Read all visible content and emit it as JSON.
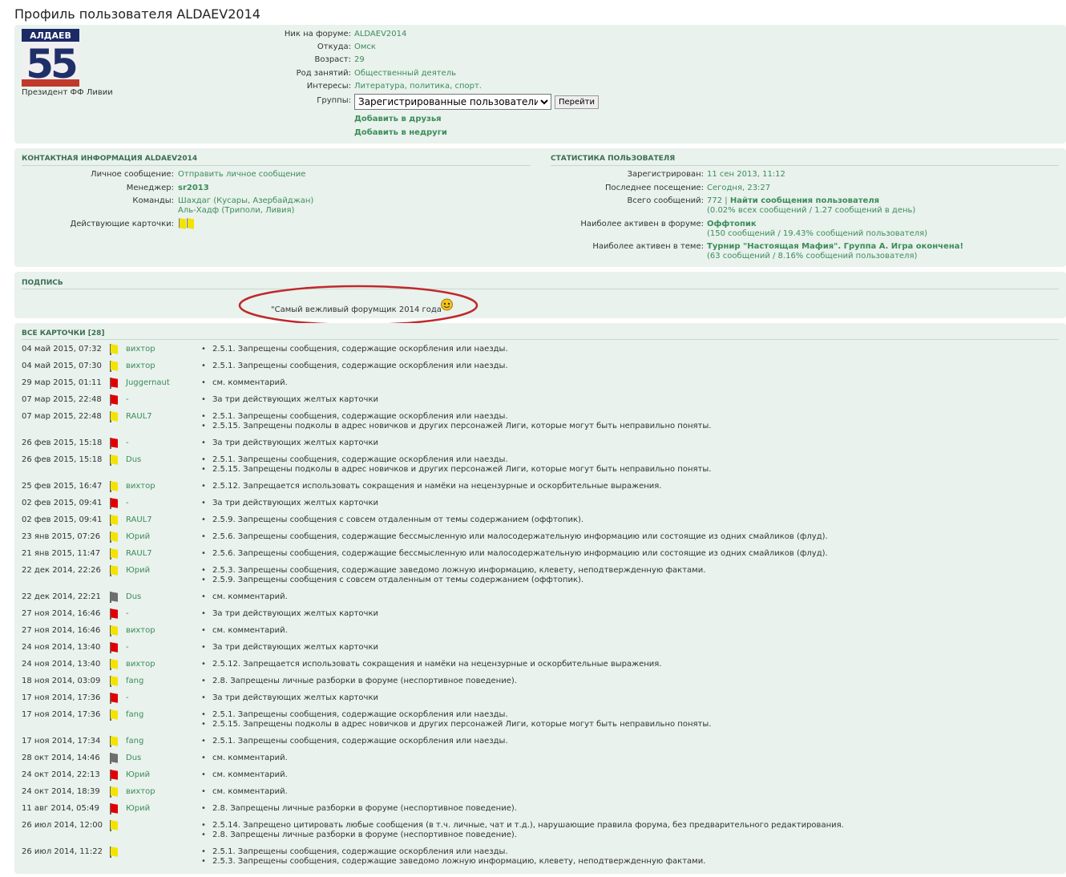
{
  "page_title": "Профиль пользователя ALDAEV2014",
  "profile": {
    "avatar_name": "АЛДАЕВ",
    "avatar_number": "55",
    "rank": "Президент ФФ Ливии",
    "fields": {
      "nick_label": "Ник на форуме:",
      "nick": "ALDAEV2014",
      "from_label": "Откуда:",
      "from": "Омск",
      "age_label": "Возраст:",
      "age": "29",
      "occupation_label": "Род занятий:",
      "occupation": "Общественный деятель",
      "interests_label": "Интересы:",
      "interests": "Литература, политика, спорт.",
      "groups_label": "Группы:"
    },
    "group_selected": "Зарегистрированные пользователи",
    "go_button": "Перейти",
    "add_friend": "Добавить в друзья",
    "add_foe": "Добавить в недруги"
  },
  "contact": {
    "title": "КОНТАКТНАЯ ИНФОРМАЦИЯ ALDAEV2014",
    "pm_label": "Личное сообщение:",
    "pm_link": "Отправить личное сообщение",
    "manager_label": "Менеджер:",
    "manager": "sr2013",
    "teams_label": "Команды:",
    "team1": "Шахдаг (Кусары, Азербайджан)",
    "team2": "Аль-Хадф (Триполи, Ливия)",
    "cards_label": "Действующие карточки:"
  },
  "stats": {
    "title": "СТАТИСТИКА ПОЛЬЗОВАТЕЛЯ",
    "registered_label": "Зарегистрирован:",
    "registered": "11 сен 2013, 11:12",
    "last_visit_label": "Последнее посещение:",
    "last_visit": "Сегодня, 23:27",
    "posts_label": "Всего сообщений:",
    "posts": "772",
    "posts_sep": "|",
    "find_posts": "Найти сообщения пользователя",
    "posts_detail": "(0.02% всех сообщений / 1.27 сообщений в день)",
    "active_forum_label": "Наиболее активен в форуме:",
    "active_forum": "Оффтопик",
    "active_forum_detail": "(150 сообщений / 19.43% сообщений пользователя)",
    "active_topic_label": "Наиболее активен в теме:",
    "active_topic": "Турнир \"Настоящая Мафия\". Группа А. Игра окончена!",
    "active_topic_detail": "(63 сообщений / 8.16% сообщений пользователя)"
  },
  "signature": {
    "title": "ПОДПИСЬ",
    "text": "\"Самый вежливый форумщик 2014 года\""
  },
  "cards": {
    "title": "ВСЕ КАРТОЧКИ",
    "count": "[28]",
    "rows": [
      {
        "date": "04 май 2015, 07:32",
        "color": "yellow",
        "mod": "вихтор",
        "reasons": [
          "2.5.1. Запрещены сообщения, содержащие оскорбления или наезды."
        ]
      },
      {
        "date": "04 май 2015, 07:30",
        "color": "yellow",
        "mod": "вихтор",
        "reasons": [
          "2.5.1. Запрещены сообщения, содержащие оскорбления или наезды."
        ]
      },
      {
        "date": "29 мар 2015, 01:11",
        "color": "red",
        "mod": "Juggernaut",
        "reasons": [
          "см. комментарий."
        ]
      },
      {
        "date": "07 мар 2015, 22:48",
        "color": "red",
        "mod": "-",
        "reasons": [
          "За три действующих желтых карточки"
        ]
      },
      {
        "date": "07 мар 2015, 22:48",
        "color": "yellow",
        "mod": "RAUL7",
        "reasons": [
          "2.5.1. Запрещены сообщения, содержащие оскорбления или наезды.",
          "2.5.15. Запрещены подколы в адрес новичков и других персонажей Лиги, которые могут быть неправильно поняты."
        ]
      },
      {
        "date": "26 фев 2015, 15:18",
        "color": "red",
        "mod": "-",
        "reasons": [
          "За три действующих желтых карточки"
        ]
      },
      {
        "date": "26 фев 2015, 15:18",
        "color": "yellow",
        "mod": "Dus",
        "reasons": [
          "2.5.1. Запрещены сообщения, содержащие оскорбления или наезды.",
          "2.5.15. Запрещены подколы в адрес новичков и других персонажей Лиги, которые могут быть неправильно поняты."
        ]
      },
      {
        "date": "25 фев 2015, 16:47",
        "color": "yellow",
        "mod": "вихтор",
        "reasons": [
          "2.5.12. Запрещается использовать сокращения и намёки на нецензурные и оскорбительные выражения."
        ]
      },
      {
        "date": "02 фев 2015, 09:41",
        "color": "red",
        "mod": "-",
        "reasons": [
          "За три действующих желтых карточки"
        ]
      },
      {
        "date": "02 фев 2015, 09:41",
        "color": "yellow",
        "mod": "RAUL7",
        "reasons": [
          "2.5.9. Запрещены сообщения с совсем отдаленным от темы содержанием (оффтопик)."
        ]
      },
      {
        "date": "23 янв 2015, 07:26",
        "color": "yellow",
        "mod": "Юрий",
        "reasons": [
          "2.5.6. Запрещены сообщения, содержащие бессмысленную или малосодержательную информацию или состоящие из одних смайликов (флуд)."
        ]
      },
      {
        "date": "21 янв 2015, 11:47",
        "color": "yellow",
        "mod": "RAUL7",
        "reasons": [
          "2.5.6. Запрещены сообщения, содержащие бессмысленную или малосодержательную информацию или состоящие из одних смайликов (флуд)."
        ]
      },
      {
        "date": "22 дек 2014, 22:26",
        "color": "yellow",
        "mod": "Юрий",
        "reasons": [
          "2.5.3. Запрещены сообщения, содержащие заведомо ложную информацию, клевету, неподтвержденную фактами.",
          "2.5.9. Запрещены сообщения с совсем отдаленным от темы содержанием (оффтопик)."
        ]
      },
      {
        "date": "22 дек 2014, 22:21",
        "color": "gray",
        "mod": "Dus",
        "reasons": [
          "см. комментарий."
        ]
      },
      {
        "date": "27 ноя 2014, 16:46",
        "color": "red",
        "mod": "-",
        "reasons": [
          "За три действующих желтых карточки"
        ]
      },
      {
        "date": "27 ноя 2014, 16:46",
        "color": "yellow",
        "mod": "вихтор",
        "reasons": [
          "см. комментарий."
        ]
      },
      {
        "date": "24 ноя 2014, 13:40",
        "color": "red",
        "mod": "-",
        "reasons": [
          "За три действующих желтых карточки"
        ]
      },
      {
        "date": "24 ноя 2014, 13:40",
        "color": "yellow",
        "mod": "вихтор",
        "reasons": [
          "2.5.12. Запрещается использовать сокращения и намёки на нецензурные и оскорбительные выражения."
        ]
      },
      {
        "date": "18 ноя 2014, 03:09",
        "color": "yellow",
        "mod": "fang",
        "reasons": [
          "2.8. Запрещены личные разборки в форуме (неспортивное поведение)."
        ]
      },
      {
        "date": "17 ноя 2014, 17:36",
        "color": "red",
        "mod": "-",
        "reasons": [
          "За три действующих желтых карточки"
        ]
      },
      {
        "date": "17 ноя 2014, 17:36",
        "color": "yellow",
        "mod": "fang",
        "reasons": [
          "2.5.1. Запрещены сообщения, содержащие оскорбления или наезды.",
          "2.5.15. Запрещены подколы в адрес новичков и других персонажей Лиги, которые могут быть неправильно поняты."
        ]
      },
      {
        "date": "17 ноя 2014, 17:34",
        "color": "yellow",
        "mod": "fang",
        "reasons": [
          "2.5.1. Запрещены сообщения, содержащие оскорбления или наезды."
        ]
      },
      {
        "date": "28 окт 2014, 14:46",
        "color": "gray",
        "mod": "Dus",
        "reasons": [
          "см. комментарий."
        ]
      },
      {
        "date": "24 окт 2014, 22:13",
        "color": "red",
        "mod": "Юрий",
        "reasons": [
          "см. комментарий."
        ]
      },
      {
        "date": "24 окт 2014, 18:39",
        "color": "yellow",
        "mod": "вихтор",
        "reasons": [
          "см. комментарий."
        ]
      },
      {
        "date": "11 авг 2014, 05:49",
        "color": "red",
        "mod": "Юрий",
        "reasons": [
          "2.8. Запрещены личные разборки в форуме (неспортивное поведение)."
        ]
      },
      {
        "date": "26 июл 2014, 12:00",
        "color": "yellow",
        "mod": "",
        "reasons": [
          "2.5.14. Запрещено цитировать любые сообщения (в т.ч. личные, чат и т.д.), нарушающие правила форума, без предварительного редактирования.",
          "2.8. Запрещены личные разборки в форуме (неспортивное поведение)."
        ]
      },
      {
        "date": "26 июл 2014, 11:22",
        "color": "yellow",
        "mod": "",
        "reasons": [
          "2.5.1. Запрещены сообщения, содержащие оскорбления или наезды.",
          "2.5.3. Запрещены сообщения, содержащие заведомо ложную информацию, клевету, неподтвержденную фактами."
        ]
      }
    ]
  },
  "colors": {
    "panel": "#e9f2ed",
    "link": "#3c8c5a",
    "yellow_card": "#f2e400",
    "red_card": "#e00000",
    "gray_card": "#6e6e6e",
    "annotation": "#c0282d"
  }
}
